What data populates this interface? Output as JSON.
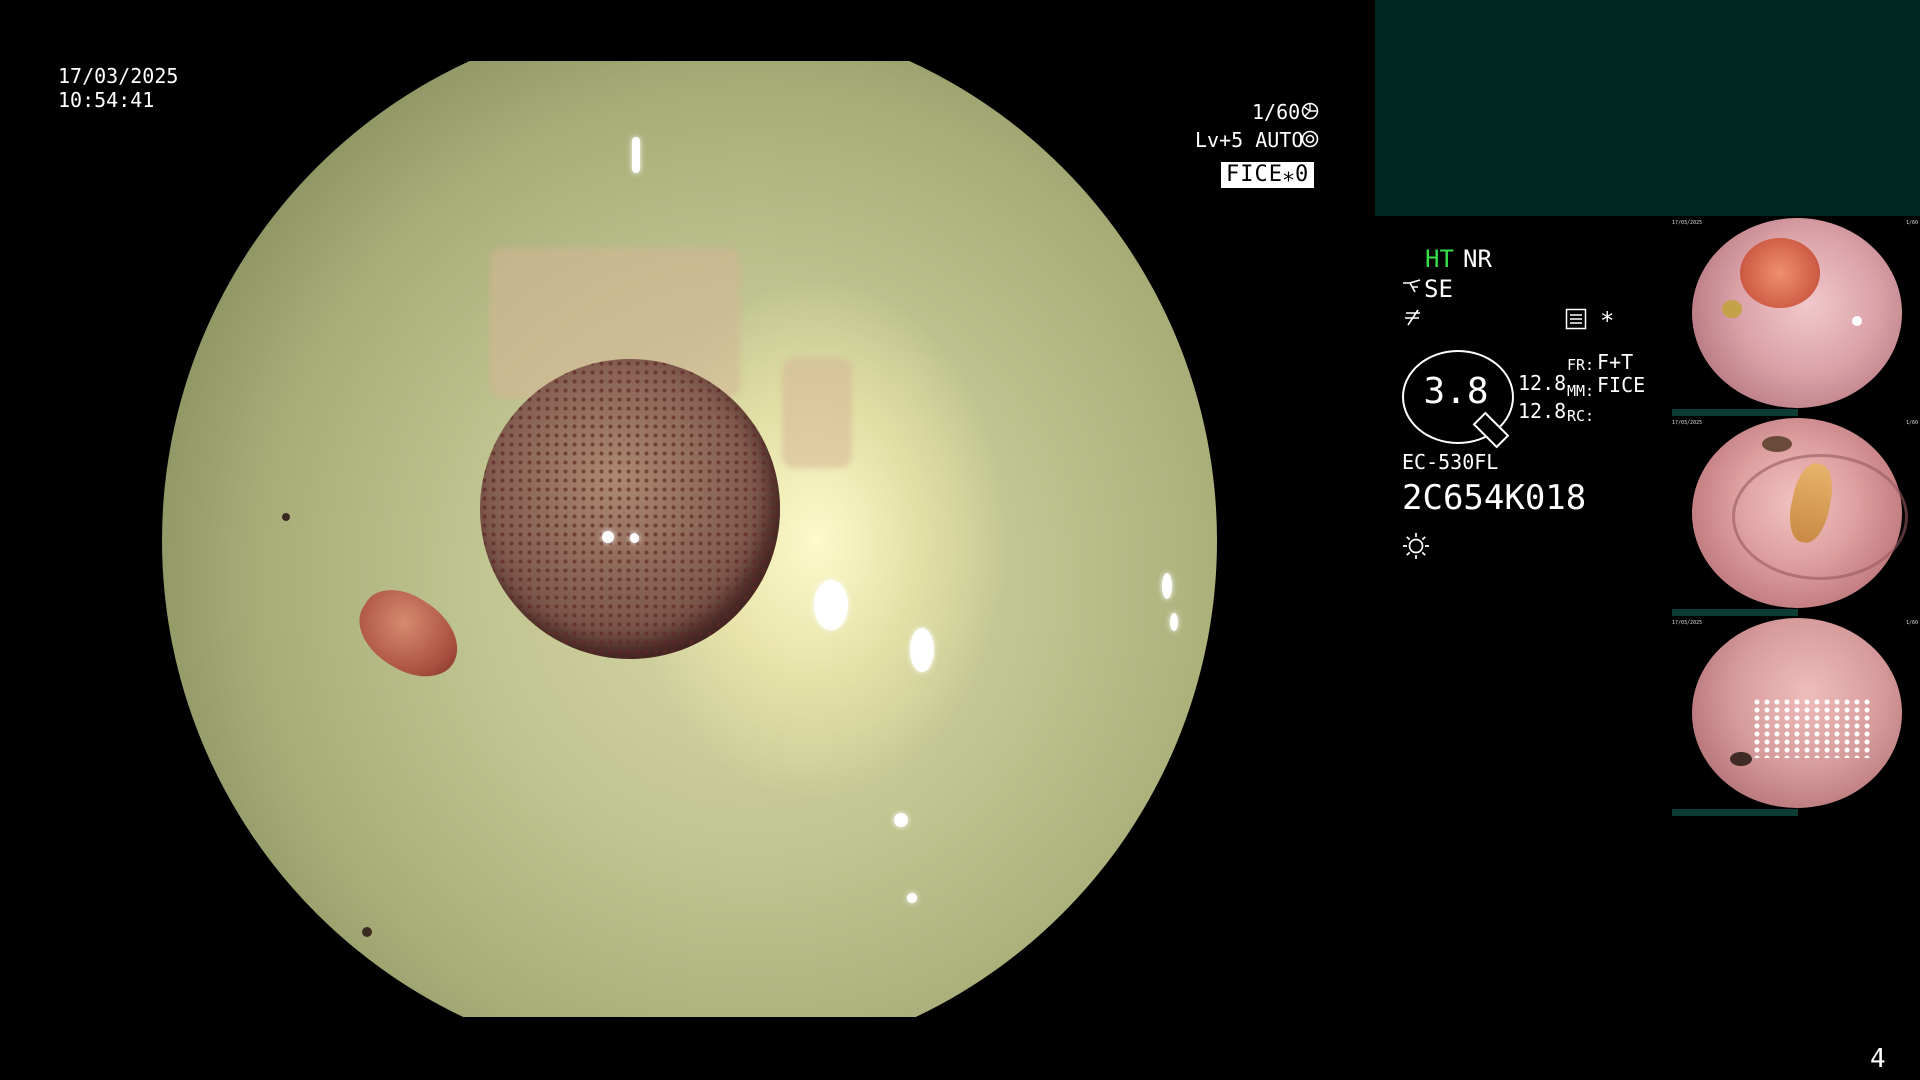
{
  "datetime": {
    "date": "17/03/2025",
    "time": "10:54:41"
  },
  "camera": {
    "shutter": "1/60",
    "shutter_icon": "shutter-icon",
    "level": "Lv+5 AUTO",
    "level_icon": "iris-icon",
    "fice": "FICE⁎0"
  },
  "modes": {
    "ht": "HT",
    "nr": "NR",
    "se": "SE",
    "se_icon": "structure-enhance-icon",
    "freeze_icon": "freeze-icon",
    "menu_icon": "menu-icon",
    "asterisk": "*"
  },
  "lens": {
    "value": "3.8",
    "val_a": "12.8",
    "val_b": "12.8"
  },
  "settings": {
    "fr_label": "FR:",
    "fr_value": "F+T",
    "mm_label": "MM:",
    "mm_value": "FICE",
    "rc_label": "RC:",
    "rc_value": ""
  },
  "scope": {
    "model": "EC-530FL",
    "serial": "2C654K018",
    "light_icon": "light-icon"
  },
  "page_number": "4",
  "colors": {
    "panel_bg": "#012620",
    "ht_green": "#35e24a",
    "thumb_bar": "#0c3d34"
  },
  "thumbnails": [
    {
      "name": "thumbnail-1"
    },
    {
      "name": "thumbnail-2"
    },
    {
      "name": "thumbnail-3"
    }
  ]
}
